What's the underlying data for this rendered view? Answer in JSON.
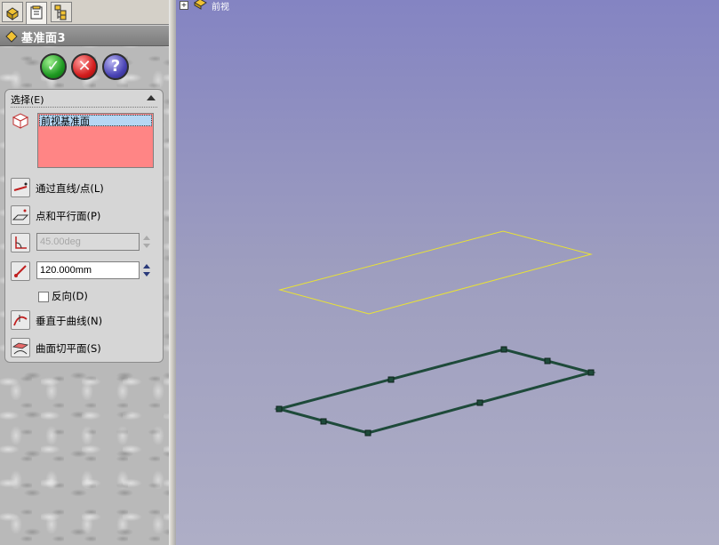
{
  "tabs": [
    {
      "name": "featuremanager-tab",
      "icon": "feature-tree-icon",
      "active": false
    },
    {
      "name": "propertymanager-tab",
      "icon": "property-manager-icon",
      "active": true
    },
    {
      "name": "configurationmanager-tab",
      "icon": "configuration-icon",
      "active": false
    }
  ],
  "feature": {
    "title": "基准面3",
    "icon": "plane-icon"
  },
  "actions": {
    "ok_symbol": "✓",
    "cancel_symbol": "✕",
    "help_symbol": "?"
  },
  "selection": {
    "group_label": "选择(E)",
    "items": [
      "前视基准面"
    ],
    "box_color": "#ff8585"
  },
  "options": {
    "through_line_point": "通过直线/点(L)",
    "point_parallel": "点和平行面(P)",
    "angle_value": "45.00deg",
    "offset_value": "120.000mm",
    "reverse_label": "反向(D)",
    "normal_to_curve": "垂直于曲线(N)",
    "on_surface": "曲面切平面(S)"
  },
  "tree": {
    "root_label": "前视",
    "expand_symbol": "+"
  },
  "colors": {
    "preview_plane": "#e9e234",
    "reference_plane": "#1e4a3a",
    "viewport_top": "#8484c2",
    "viewport_bottom": "#aeaec6"
  }
}
